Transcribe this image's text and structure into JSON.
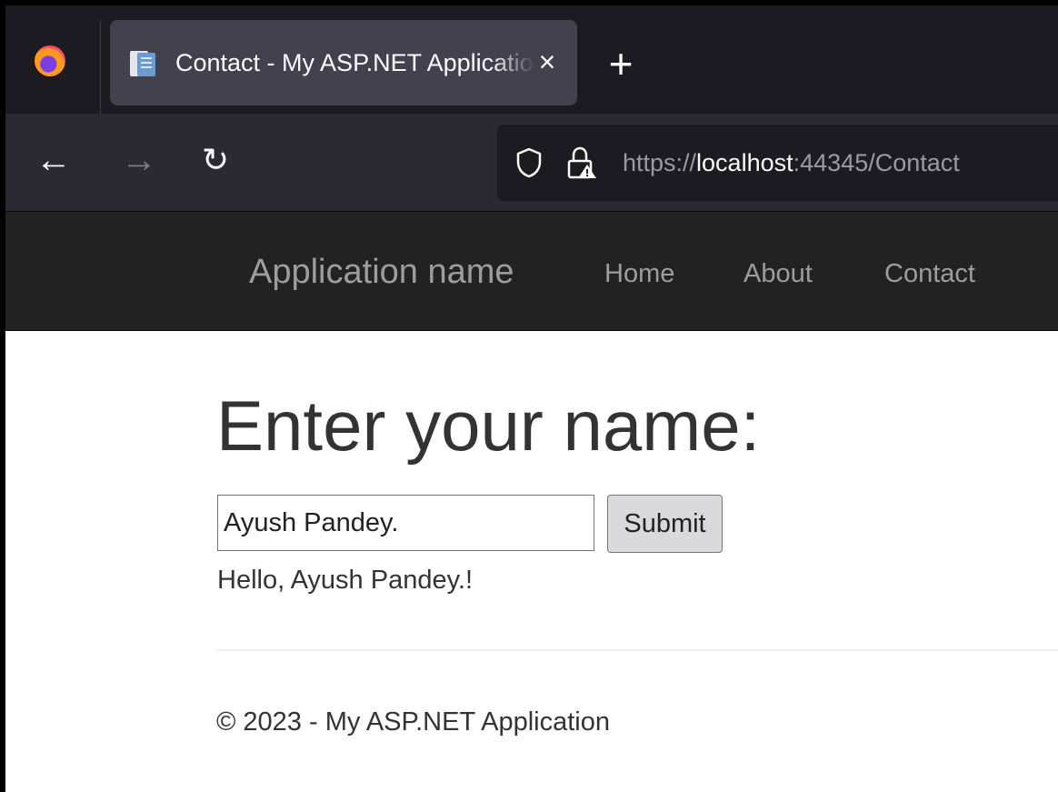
{
  "browser": {
    "tab": {
      "title": "Contact - My ASP.NET Application",
      "close_glyph": "×"
    },
    "new_tab_glyph": "+",
    "nav": {
      "back_glyph": "←",
      "forward_glyph": "→",
      "reload_glyph": "↻"
    },
    "url": {
      "scheme": "https://",
      "host": "localhost",
      "rest": ":44345/Contact"
    },
    "icons": [
      "firefox-logo",
      "page-icon",
      "close-icon",
      "plus-icon",
      "back-arrow-icon",
      "forward-arrow-icon",
      "reload-icon",
      "shield-icon",
      "lock-warning-icon"
    ]
  },
  "site": {
    "brand": "Application name",
    "nav": [
      {
        "label": "Home"
      },
      {
        "label": "About"
      },
      {
        "label": "Contact"
      }
    ]
  },
  "main": {
    "heading": "Enter your name:",
    "input_value": "Ayush Pandey.",
    "submit_label": "Submit",
    "greeting": "Hello, Ayush Pandey.!"
  },
  "footer": {
    "text": "© 2023 - My ASP.NET Application"
  },
  "colors": {
    "tabstrip": "#1c1b22",
    "active_tab": "#42414d",
    "toolbar": "#2b2a33",
    "site_navbar": "#222222",
    "nav_link": "#9d9d9d",
    "body_text": "#333333"
  }
}
